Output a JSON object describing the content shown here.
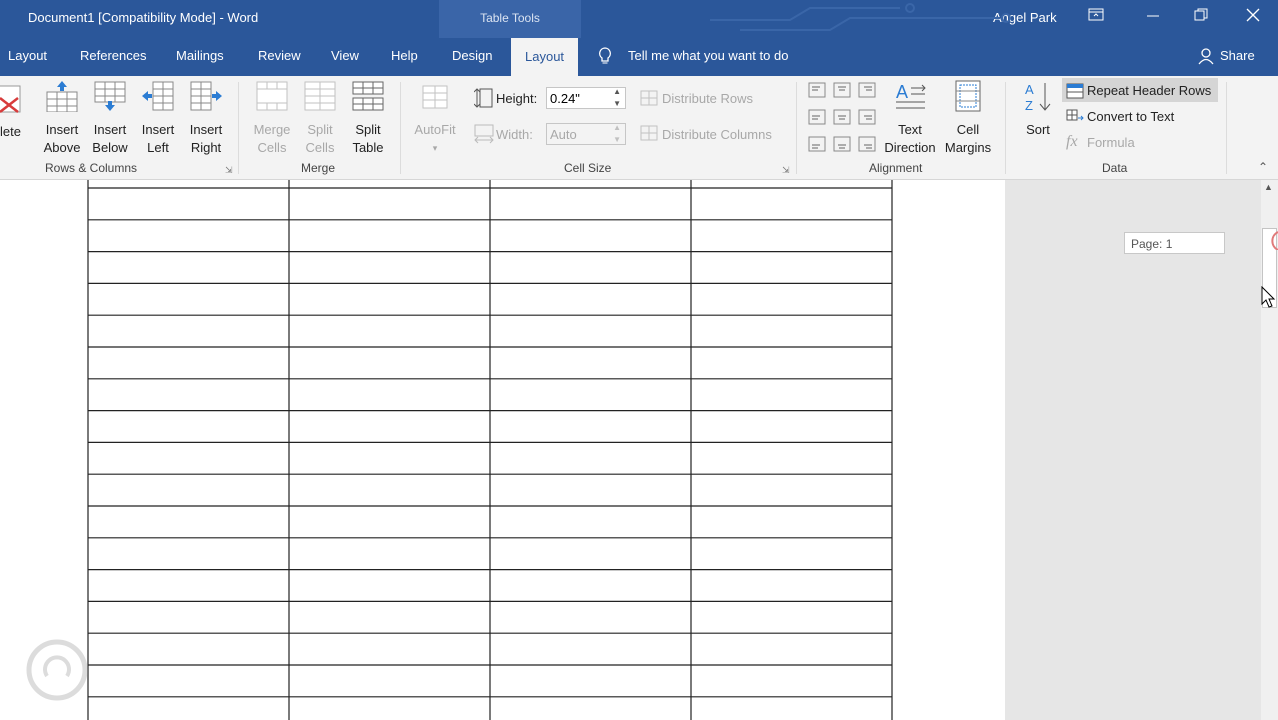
{
  "titlebar": {
    "document_title": "Document1 [Compatibility Mode]  -  Word",
    "contextual_tools": "Table Tools",
    "user_name": "Angel Park"
  },
  "tabs": {
    "layout_doc": "Layout",
    "references": "References",
    "mailings": "Mailings",
    "review": "Review",
    "view": "View",
    "help": "Help",
    "design": "Design",
    "layout_table": "Layout",
    "tell_me": "Tell me what you want to do",
    "share": "Share"
  },
  "ribbon": {
    "rows_columns": {
      "delete_label": "lete",
      "insert_above": [
        "Insert",
        "Above"
      ],
      "insert_below": [
        "Insert",
        "Below"
      ],
      "insert_left": [
        "Insert",
        "Left"
      ],
      "insert_right": [
        "Insert",
        "Right"
      ],
      "group_label": "Rows & Columns"
    },
    "merge": {
      "merge_cells": [
        "Merge",
        "Cells"
      ],
      "split_cells": [
        "Split",
        "Cells"
      ],
      "split_table": [
        "Split",
        "Table"
      ],
      "group_label": "Merge"
    },
    "cell_size": {
      "autofit": "AutoFit",
      "height_label": "Height:",
      "height_value": "0.24\"",
      "width_label": "Width:",
      "width_value": "Auto",
      "distribute_rows": "Distribute Rows",
      "distribute_columns": "Distribute Columns",
      "group_label": "Cell Size"
    },
    "alignment": {
      "text_direction": [
        "Text",
        "Direction"
      ],
      "cell_margins": [
        "Cell",
        "Margins"
      ],
      "group_label": "Alignment"
    },
    "data": {
      "sort": "Sort",
      "repeat_header_rows": "Repeat Header Rows",
      "convert_to_text": "Convert to Text",
      "formula": "Formula",
      "group_label": "Data"
    }
  },
  "side_panel": {
    "page_indicator": "Page: 1"
  },
  "table": {
    "columns": 4,
    "rows": 17
  },
  "colors": {
    "accent": "#2b579a",
    "ribbon_bg": "#f3f3f3"
  }
}
